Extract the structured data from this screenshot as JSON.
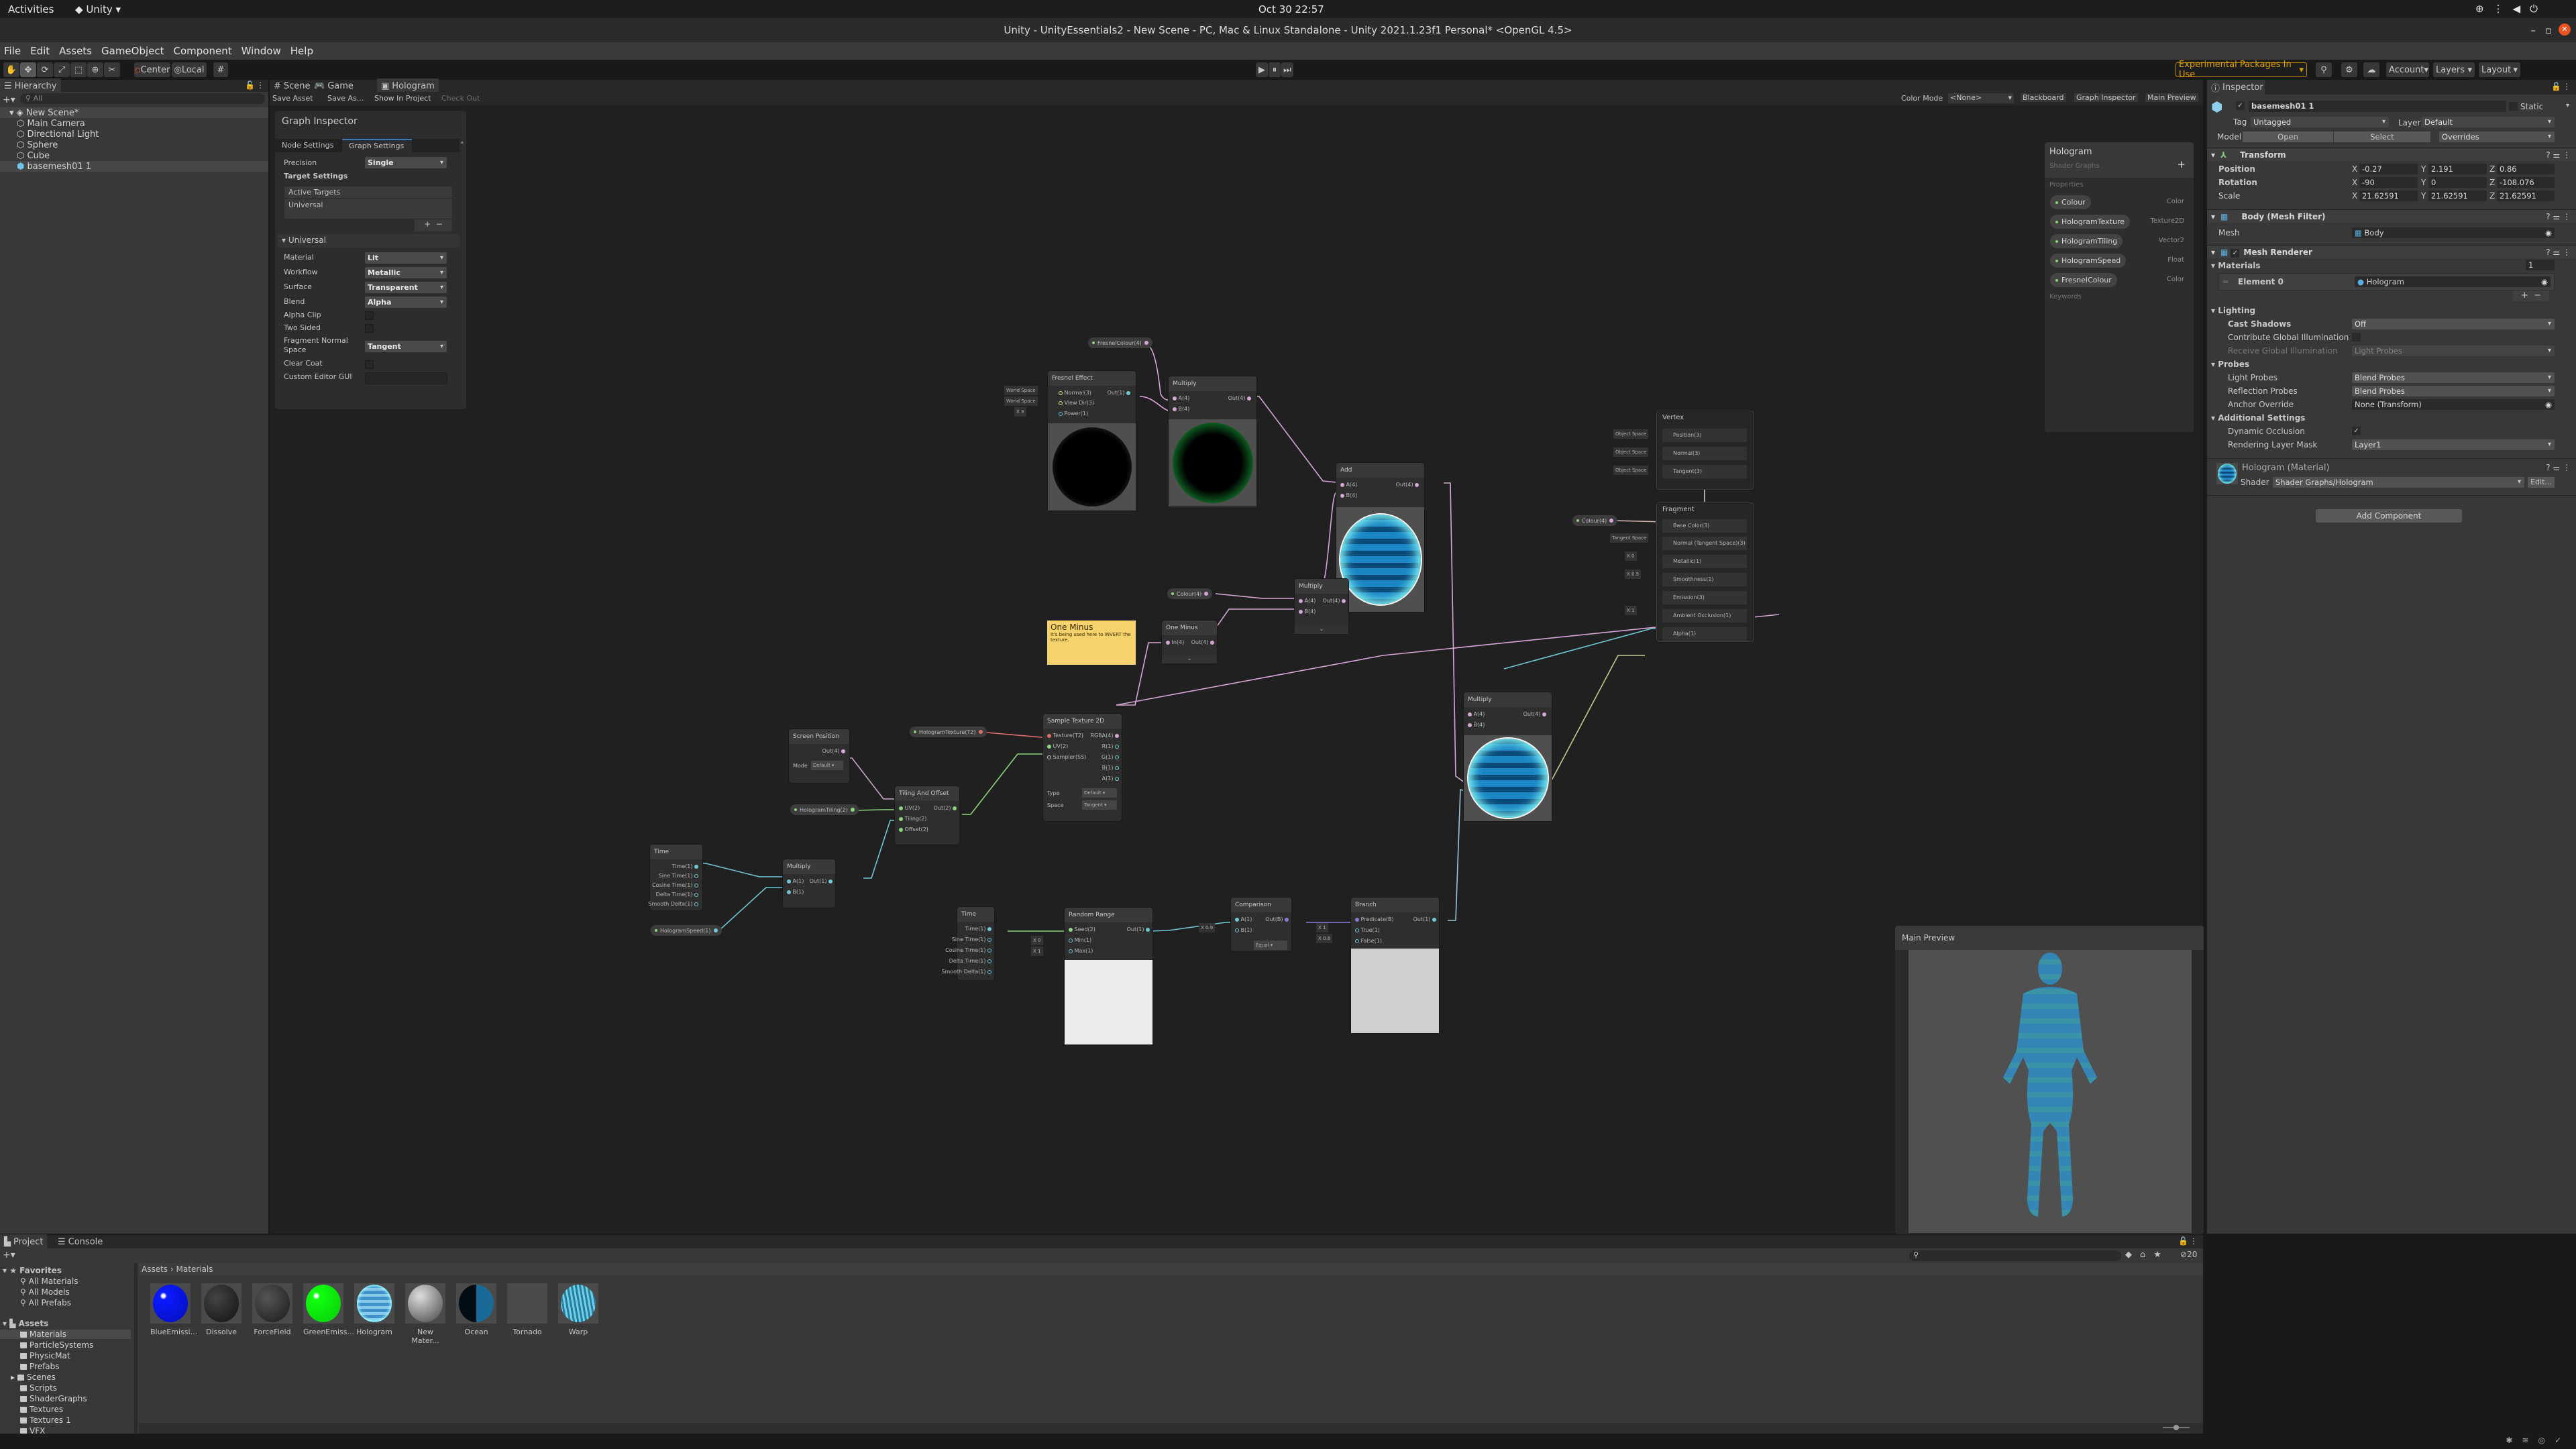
{
  "os_bar": {
    "activities": "Activities",
    "app_menu": "Unity",
    "clock": "Oct 30  22:57"
  },
  "window": {
    "title": "Unity - UnityEssentials2 - New Scene - PC, Mac & Linux Standalone - Unity 2021.1.23f1 Personal* <OpenGL 4.5>"
  },
  "menu": [
    "File",
    "Edit",
    "Assets",
    "GameObject",
    "Component",
    "Window",
    "Help"
  ],
  "toolbar": {
    "pivot": "Center",
    "space": "Local",
    "experimental": "Experimental Packages In Use",
    "account": "Account",
    "layers": "Layers",
    "layout": "Layout"
  },
  "hierarchy": {
    "tab": "Hierarchy",
    "search_placeholder": "All",
    "scene": "New Scene*",
    "items": [
      "Main Camera",
      "Directional Light",
      "Sphere",
      "Cube",
      "basemesh01 1"
    ]
  },
  "center_tabs": [
    "Scene",
    "Game",
    "Hologram"
  ],
  "graph_toolbar": {
    "save_asset": "Save Asset",
    "save_as": "Save As...",
    "show_in_project": "Show In Project",
    "check_out": "Check Out",
    "color_mode_label": "Color Mode",
    "color_mode_value": "<None>",
    "blackboard": "Blackboard",
    "graph_inspector": "Graph Inspector",
    "main_preview": "Main Preview"
  },
  "graph_inspector": {
    "title": "Graph Inspector",
    "tabs": [
      "Node Settings",
      "Graph Settings"
    ],
    "active_tab": "Graph Settings",
    "precision_label": "Precision",
    "precision": "Single",
    "target_settings": "Target Settings",
    "active_targets": "Active Targets",
    "target": "Universal",
    "section": "Universal",
    "rows": [
      {
        "label": "Material",
        "value": "Lit",
        "type": "dropdown"
      },
      {
        "label": "Workflow",
        "value": "Metallic",
        "type": "dropdown"
      },
      {
        "label": "Surface",
        "value": "Transparent",
        "type": "dropdown"
      },
      {
        "label": "Blend",
        "value": "Alpha",
        "type": "dropdown"
      },
      {
        "label": "Alpha Clip",
        "value": false,
        "type": "checkbox"
      },
      {
        "label": "Two Sided",
        "value": false,
        "type": "checkbox"
      },
      {
        "label": "Fragment Normal Space",
        "value": "Tangent",
        "type": "dropdown"
      },
      {
        "label": "Clear Coat",
        "value": false,
        "type": "checkbox"
      },
      {
        "label": "Custom Editor GUI",
        "value": "",
        "type": "text"
      }
    ]
  },
  "blackboard": {
    "title": "Hologram",
    "subtitle": "Shader Graphs",
    "properties_label": "Properties",
    "keywords_label": "Keywords",
    "properties": [
      {
        "name": "Colour",
        "type": "Color"
      },
      {
        "name": "HologramTexture",
        "type": "Texture2D"
      },
      {
        "name": "HologramTiling",
        "type": "Vector2"
      },
      {
        "name": "HologramSpeed",
        "type": "Float"
      },
      {
        "name": "FresnelColour",
        "type": "Color"
      }
    ]
  },
  "nodes": {
    "fresnel": {
      "title": "Fresnel Effect",
      "inputs": [
        "Normal(3)",
        "View Dir(3)",
        "Power(1)"
      ],
      "output": "Out(1)",
      "normal_space": "World Space",
      "view_space": "World Space",
      "power": "3"
    },
    "fresnel_colour_prop": "FresnelColour(4)",
    "multiply_fresnel": {
      "title": "Multiply",
      "inputs": [
        "A(4)",
        "B(4)"
      ],
      "output": "Out(4)"
    },
    "add": {
      "title": "Add",
      "inputs": [
        "A(4)",
        "B(4)"
      ],
      "output": "Out(4)"
    },
    "colour_prop": "Colour(4)",
    "multiply_colour": {
      "title": "Multiply",
      "inputs": [
        "A(4)",
        "B(4)"
      ],
      "output": "Out(4)"
    },
    "one_minus": {
      "title": "One Minus",
      "input": "In(4)",
      "output": "Out(4)"
    },
    "sticky_note": {
      "title": "One Minus",
      "body": "It's being used here to INVERT the texture."
    },
    "hologram_texture_prop": "HologramTexture(T2)",
    "sample_texture": {
      "title": "Sample Texture 2D",
      "inputs": [
        "Texture(T2)",
        "UV(2)",
        "Sampler(SS)"
      ],
      "outputs": [
        "RGBA(4)",
        "R(1)",
        "G(1)",
        "B(1)",
        "A(1)"
      ],
      "type_label": "Type",
      "type": "Default",
      "space_label": "Space",
      "space": "Tangent"
    },
    "screen_position": {
      "title": "Screen Position",
      "output": "Out(4)",
      "mode_label": "Mode",
      "mode": "Default"
    },
    "tiling_offset": {
      "title": "Tiling And Offset",
      "inputs": [
        "UV(2)",
        "Tiling(2)",
        "Offset(2)"
      ],
      "output": "Out(2)"
    },
    "hologram_tiling_prop": "HologramTiling(2)",
    "time_a": {
      "title": "Time",
      "outputs": [
        "Time(1)",
        "Sine Time(1)",
        "Cosine Time(1)",
        "Delta Time(1)",
        "Smooth Delta(1)"
      ]
    },
    "multiply_time": {
      "title": "Multiply",
      "inputs": [
        "A(1)",
        "B(1)"
      ],
      "output": "Out(1)"
    },
    "hologram_speed_prop": "HologramSpeed(1)",
    "time_b": {
      "title": "Time",
      "outputs": [
        "Time(1)",
        "Sine Time(1)",
        "Cosine Time(1)",
        "Delta Time(1)",
        "Smooth Delta(1)"
      ]
    },
    "random_range": {
      "title": "Random Range",
      "inputs": [
        "Seed(2)",
        "Min(1)",
        "Max(1)"
      ],
      "output": "Out(1)",
      "min": "0",
      "max": "1"
    },
    "comparison": {
      "title": "Comparison",
      "inputs": [
        "A(1)",
        "B(1)"
      ],
      "output": "Out(B)",
      "b": "0.9",
      "op": "Equal"
    },
    "branch": {
      "title": "Branch",
      "inputs": [
        "Predicate(B)",
        "True(1)",
        "False(1)"
      ],
      "output": "Out(1)",
      "true_val": "1",
      "false_val": "0.8"
    },
    "multiply_final": {
      "title": "Multiply",
      "inputs": [
        "A(4)",
        "B(4)"
      ],
      "output": "Out(4)"
    },
    "vertex": {
      "title": "Vertex",
      "slots": [
        "Position(3)",
        "Normal(3)",
        "Tangent(3)"
      ],
      "space": "Object Space"
    },
    "fragment": {
      "title": "Fragment",
      "slots": [
        "Base Color(3)",
        "Normal (Tangent Space)(3)",
        "Metallic(1)",
        "Smoothness(1)",
        "Emission(3)",
        "Ambient Occlusion(1)",
        "Alpha(1)"
      ],
      "colour_prop": "Colour(4)",
      "normal_space": "Tangent Space",
      "metallic": "0",
      "smoothness": "0.5",
      "ao": "1"
    }
  },
  "main_preview": {
    "title": "Main Preview"
  },
  "inspector": {
    "tab": "Inspector",
    "object_name": "basemesh01 1",
    "static_label": "Static",
    "tag_label": "Tag",
    "tag": "Untagged",
    "layer_label": "Layer",
    "layer": "Default",
    "model_label": "Model",
    "open": "Open",
    "select": "Select",
    "overrides": "Overrides",
    "transform": {
      "title": "Transform",
      "position": {
        "label": "Position",
        "x": "-0.27",
        "y": "2.191",
        "z": "0.86"
      },
      "rotation": {
        "label": "Rotation",
        "x": "-90",
        "y": "0",
        "z": "-108.076"
      },
      "scale": {
        "label": "Scale",
        "x": "21.62591",
        "y": "21.62591",
        "z": "21.62591"
      }
    },
    "mesh_filter": {
      "title": "Body (Mesh Filter)",
      "mesh_label": "Mesh",
      "mesh": "Body"
    },
    "mesh_renderer": {
      "title": "Mesh Renderer",
      "materials_label": "Materials",
      "materials_count": "1",
      "element_label": "Element 0",
      "element_value": "Hologram",
      "lighting": "Lighting",
      "cast_shadows_label": "Cast Shadows",
      "cast_shadows": "Off",
      "contribute_gi": "Contribute Global Illumination",
      "receive_gi_label": "Receive Global Illumination",
      "receive_gi": "Light Probes",
      "probes": "Probes",
      "light_probes_label": "Light Probes",
      "light_probes": "Blend Probes",
      "reflection_probes_label": "Reflection Probes",
      "reflection_probes": "Blend Probes",
      "anchor_label": "Anchor Override",
      "anchor": "None (Transform)",
      "additional": "Additional Settings",
      "dynamic_occlusion": "Dynamic Occlusion",
      "rendering_layer_label": "Rendering Layer Mask",
      "rendering_layer": "Layer1"
    },
    "material": {
      "title": "Hologram (Material)",
      "shader_label": "Shader",
      "shader": "Shader Graphs/Hologram",
      "edit": "Edit..."
    },
    "add_component": "Add Component"
  },
  "project": {
    "tabs": [
      "Project",
      "Console"
    ],
    "favorites": "Favorites",
    "favorite_items": [
      "All Materials",
      "All Models",
      "All Prefabs"
    ],
    "assets": "Assets",
    "folders": [
      "Materials",
      "ParticleSystems",
      "PhysicMat",
      "Prefabs",
      "Scenes",
      "Scripts",
      "ShaderGraphs",
      "Textures",
      "Textures 1",
      "VFX"
    ],
    "selected_folder": "Materials",
    "breadcrumb": [
      "Assets",
      "Materials"
    ],
    "hidden_count": "20",
    "materials": [
      {
        "name": "BlueEmissi...",
        "color": "#0a1aff"
      },
      {
        "name": "Dissolve",
        "color": "#2a2a2a"
      },
      {
        "name": "ForceField",
        "color": "#3a3a3a"
      },
      {
        "name": "GreenEmiss...",
        "color": "#10ff10"
      },
      {
        "name": "Hologram",
        "color": "#4d9fd6"
      },
      {
        "name": "New Mater...",
        "color": "#9a9a9a"
      },
      {
        "name": "Ocean",
        "color": "#0d3a55"
      },
      {
        "name": "Tornado",
        "color": "#4a4a4a"
      },
      {
        "name": "Warp",
        "color": "#4ab4d0"
      }
    ]
  },
  "colors": {
    "accent": "#3a79bb",
    "experimental": "#e0a400",
    "wire_vec4": "#d6a6d6",
    "wire_vec1": "#6ec8d4",
    "wire_vec2": "#8bd67a",
    "wire_tex": "#e07070",
    "wire_bool": "#8a7ad8",
    "sticky": "#f6d36d"
  }
}
